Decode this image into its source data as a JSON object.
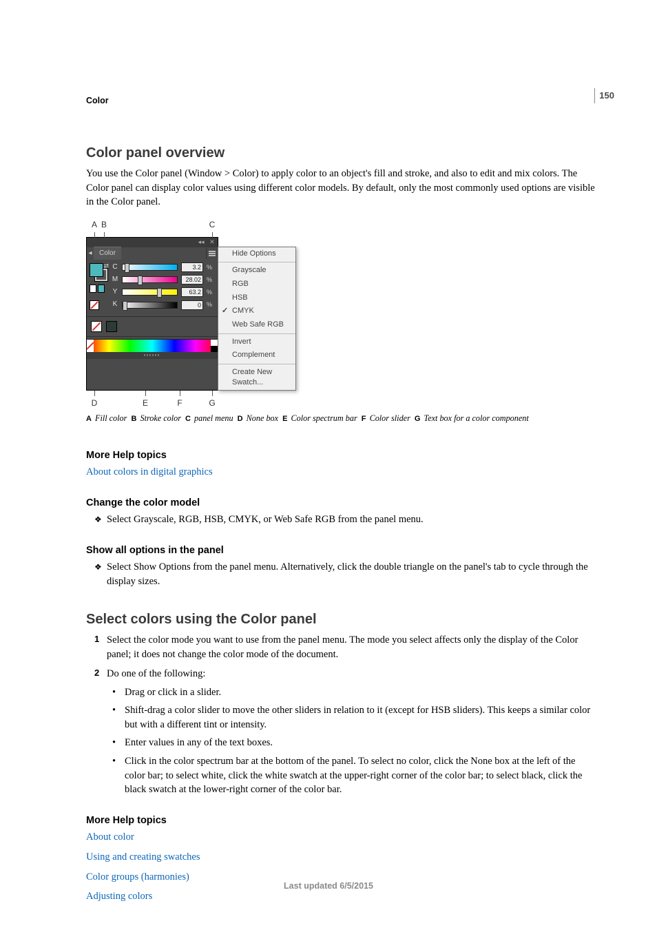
{
  "page_number": "150",
  "section": "Color",
  "h1a": "Color panel overview",
  "intro": "You use the Color panel (Window > Color) to apply color to an object's fill and stroke, and also to edit and mix colors. The Color panel can display color values using different color models. By default, only the most commonly used options are visible in the Color panel.",
  "panel": {
    "tab_label": "Color",
    "channels": [
      {
        "label": "C",
        "value": "3.2",
        "thumb_pct": 4
      },
      {
        "label": "M",
        "value": "28.02",
        "thumb_pct": 28
      },
      {
        "label": "Y",
        "value": "63.2",
        "thumb_pct": 63
      },
      {
        "label": "K",
        "value": "0",
        "thumb_pct": 0
      }
    ],
    "menu": {
      "hide_options": "Hide Options",
      "grayscale": "Grayscale",
      "rgb": "RGB",
      "hsb": "HSB",
      "cmyk": "CMYK",
      "websafe": "Web Safe RGB",
      "invert": "Invert",
      "complement": "Complement",
      "create_swatch": "Create New Swatch..."
    }
  },
  "callouts_top": {
    "A": "A",
    "B": "B",
    "C": "C"
  },
  "callouts_bot": {
    "D": "D",
    "E": "E",
    "F": "F",
    "G": "G"
  },
  "caption_parts": {
    "A": "Fill color",
    "B": "Stroke color",
    "C": "panel menu",
    "D": "None box",
    "E": "Color spectrum bar",
    "F": "Color slider",
    "G": "Text box for a color component"
  },
  "more_help_1": "More Help topics",
  "link_about_digital": "About colors in digital graphics",
  "sub_change_model": "Change the color model",
  "bullet_change_model": "Select Grayscale, RGB, HSB, CMYK, or Web Safe RGB from the panel menu.",
  "sub_show_all": "Show all options in the panel",
  "bullet_show_all": "Select Show Options from the panel menu. Alternatively, click the double triangle on the panel's tab to cycle through the display sizes.",
  "h1b": "Select colors using the Color panel",
  "step1": "Select the color mode you want to use from the panel menu. The mode you select affects only the display of the Color panel; it does not change the color mode of the document.",
  "step2": "Do one of the following:",
  "sub1": "Drag or click in a slider.",
  "sub2": "Shift-drag a color slider to move the other sliders in relation to it (except for HSB sliders). This keeps a similar color but with a different tint or intensity.",
  "sub3": "Enter values in any of the text boxes.",
  "sub4": "Click in the color spectrum bar at the bottom of the panel. To select no color, click the None box at the left of the color bar; to select white, click the white swatch at the upper-right corner of the color bar; to select black, click the black swatch at the lower-right corner of the color bar.",
  "more_help_2": "More Help topics",
  "links2": {
    "about_color": "About color",
    "swatches": "Using and creating swatches",
    "groups": "Color groups (harmonies)",
    "adjusting": "Adjusting colors"
  },
  "footer": "Last updated 6/5/2015"
}
